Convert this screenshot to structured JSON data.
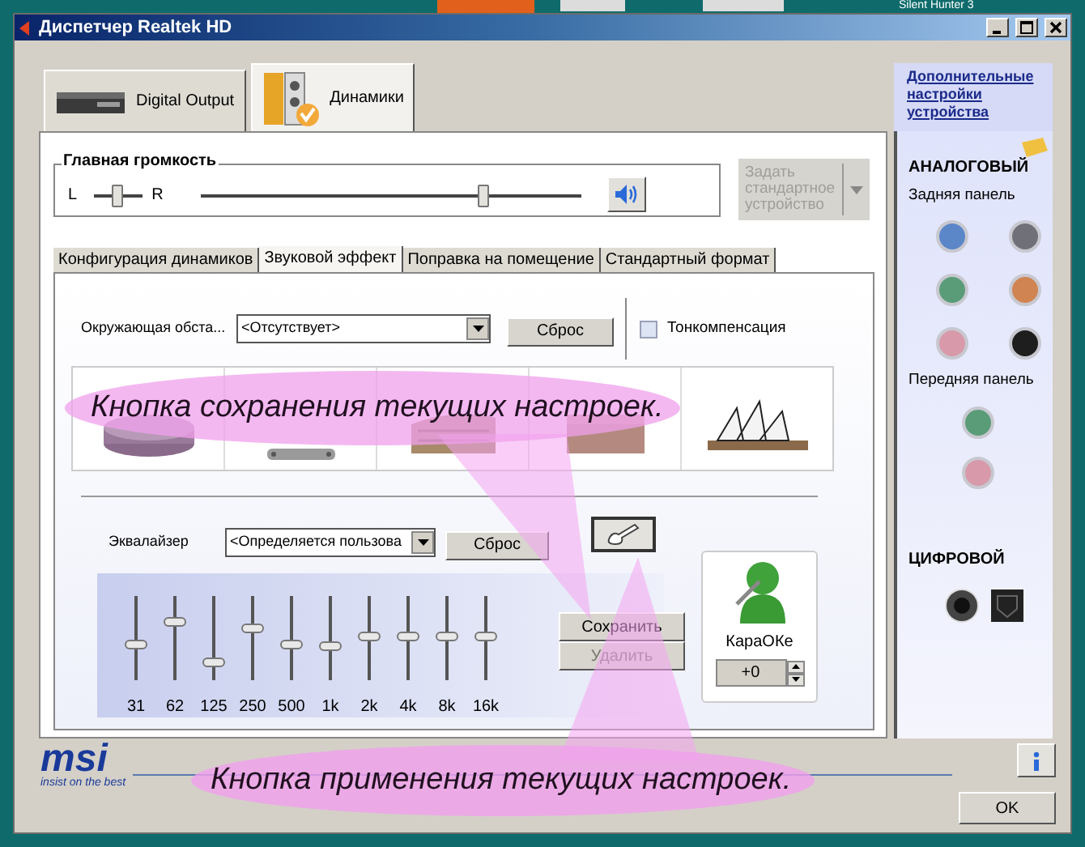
{
  "desktop": {
    "icon_label": "Silent Hunter 3"
  },
  "window": {
    "title": "Диспетчер Realtek HD"
  },
  "device_tabs": [
    {
      "label": "Digital Output",
      "selected": false
    },
    {
      "label": "Динамики",
      "selected": true
    }
  ],
  "side_link": "Дополнительные настройки устройства",
  "master_volume": {
    "title": "Главная громкость",
    "left": "L",
    "right": "R",
    "balance": {
      "level": 0.5
    },
    "volume": {
      "level": 0.75
    }
  },
  "default_device_button": {
    "label": "Задать стандартное устройство",
    "disabled": true
  },
  "sub_tabs": [
    {
      "label": "Конфигурация динамиков",
      "selected": false
    },
    {
      "label": "Звуковой эффект",
      "selected": true
    },
    {
      "label": "Поправка на помещение",
      "selected": false
    },
    {
      "label": "Стандартный формат",
      "selected": false
    }
  ],
  "environment": {
    "label": "Окружающая обста...",
    "value": "<Отсутствует>",
    "reset": "Сброс",
    "loudness": {
      "label": "Тонкомпенсация",
      "checked": false
    }
  },
  "equalizer": {
    "label": "Эквалайзер",
    "preset": "<Определяется пользова",
    "reset": "Сброс",
    "bands": [
      {
        "label": "31",
        "level": 0.42
      },
      {
        "label": "62",
        "level": 0.69
      },
      {
        "label": "125",
        "level": 0.21
      },
      {
        "label": "250",
        "level": 0.62
      },
      {
        "label": "500",
        "level": 0.42
      },
      {
        "label": "1k",
        "level": 0.4
      },
      {
        "label": "2k",
        "level": 0.52
      },
      {
        "label": "4k",
        "level": 0.52
      },
      {
        "label": "8k",
        "level": 0.52
      },
      {
        "label": "16k",
        "level": 0.52
      }
    ]
  },
  "save_button": {
    "label": "Сохранить",
    "disabled": false
  },
  "delete_button": {
    "label": "Удалить",
    "disabled": true
  },
  "karaoke": {
    "label": "КараОКе",
    "value": "+0"
  },
  "analog": {
    "title": "АНАЛОГОВЫЙ",
    "rear_label": "Задняя панель",
    "rear_jacks": [
      {
        "color": "#5b86c8"
      },
      {
        "color": "#707078"
      },
      {
        "color": "#5a9c78"
      },
      {
        "color": "#d08452"
      },
      {
        "color": "#d89aaa"
      },
      {
        "color": "#1e1e1e"
      }
    ],
    "front_label": "Передняя панель",
    "front_jacks": [
      {
        "color": "#5a9c78"
      },
      {
        "color": "#d89aaa"
      }
    ]
  },
  "digital": {
    "title": "ЦИФРОВОЙ"
  },
  "ok_button": "OK",
  "logo": {
    "mark": "msi",
    "tagline": "insist on the best"
  },
  "annotations": [
    {
      "text": "Кнопка сохранения текущих настроек."
    },
    {
      "text": "Кнопка применения текущих настроек."
    }
  ]
}
